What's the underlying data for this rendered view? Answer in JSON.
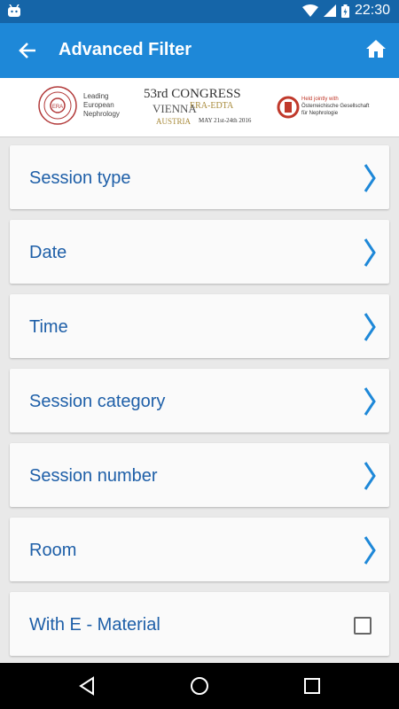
{
  "status_bar": {
    "time": "22:30"
  },
  "app_bar": {
    "title": "Advanced Filter"
  },
  "banner": {
    "era_tagline": [
      "Leading",
      "European",
      "Nephrology"
    ],
    "congress_line1": "53rd CONGRESS",
    "congress_line2": "ERA-EDTA",
    "congress_city": "VIENNA",
    "congress_country": "AUSTRIA",
    "congress_dates": "MAY 21st-24th 2016",
    "held_line1": "Held jointly with",
    "held_line2": "Österreichische Gesellschaft",
    "held_line3": "für Nephrologie"
  },
  "filters": [
    {
      "label": "Session type",
      "control": "chevron"
    },
    {
      "label": "Date",
      "control": "chevron"
    },
    {
      "label": "Time",
      "control": "chevron"
    },
    {
      "label": "Session category",
      "control": "chevron"
    },
    {
      "label": "Session number",
      "control": "chevron"
    },
    {
      "label": "Room",
      "control": "chevron"
    },
    {
      "label": "With E - Material",
      "control": "checkbox",
      "checked": false
    }
  ],
  "colors": {
    "status_bar": "#1565a8",
    "app_bar": "#1e88d8",
    "label": "#1e5fa8",
    "chevron": "#1e88d8"
  }
}
